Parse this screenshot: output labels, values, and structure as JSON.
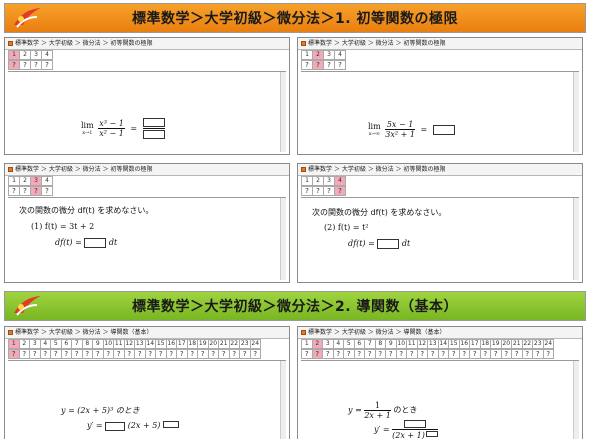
{
  "section1": {
    "title": "標準数学＞大学初級＞微分法＞1. 初等関数の極限",
    "breadcrumb": "標準数学 ＞ 大学初級 ＞ 微分法 ＞ 初等関数の極限",
    "tabs": [
      "1",
      "2",
      "3",
      "4"
    ],
    "q": "?",
    "panel1": {
      "lim": "lim",
      "sub": "x→1",
      "num": "x³ − 1",
      "den": "x² − 1",
      "eq": "="
    },
    "panel2": {
      "lim": "lim",
      "sub": "x→∞",
      "num": "5x − 1",
      "den": "3x² + 1",
      "eq": "="
    },
    "panel3": {
      "prompt": "次の関数の微分 df(t) を求めなさい。",
      "problem": "(1)  f(t) = 3t + 2",
      "lhs": "df(t) =",
      "rhs": "dt"
    },
    "panel4": {
      "prompt": "次の関数の微分 df(t) を求めなさい。",
      "problem": "(2)  f(t) = t²",
      "lhs": "df(t) =",
      "rhs": "dt"
    }
  },
  "section2": {
    "title": "標準数学＞大学初級＞微分法＞2. 導関数（基本）",
    "breadcrumb": "標準数学 ＞ 大学初級 ＞ 微分法 ＞ 導関数（基本）",
    "tabs": [
      "1",
      "2",
      "3",
      "4",
      "5",
      "6",
      "7",
      "8",
      "9",
      "10",
      "11",
      "12",
      "13",
      "14",
      "15",
      "16",
      "17",
      "18",
      "19",
      "20",
      "21",
      "22",
      "23",
      "24"
    ],
    "q": "?",
    "panel5": {
      "fn": "y = (2x + 5)³ のとき",
      "lhs": "y′ =",
      "mid": "(2x + 5)"
    },
    "panel6": {
      "fn_pre": "y =",
      "num": "1",
      "den": "2x + 1",
      "fn_post": "のとき",
      "lhs": "y′ =",
      "den2": "(2x + 1)"
    }
  },
  "colors": {
    "orange_banner": "#f39a22",
    "green_banner": "#8cc63a",
    "selected_tab": "#f4a8b8"
  }
}
